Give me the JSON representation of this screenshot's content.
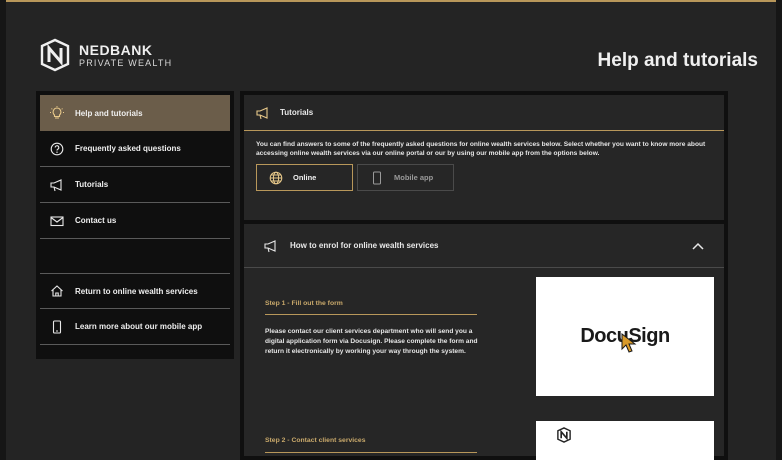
{
  "header": {
    "brand": "NEDBANK",
    "brand_sub": "PRIVATE WEALTH",
    "page_title": "Help and tutorials"
  },
  "sidebar": {
    "items": [
      {
        "label": "Help and tutorials",
        "icon": "lightbulb-icon",
        "active": true
      },
      {
        "label": "Frequently asked questions",
        "icon": "question-circle-icon"
      },
      {
        "label": "Tutorials",
        "icon": "megaphone-icon"
      },
      {
        "label": "Contact us",
        "icon": "envelope-icon"
      }
    ],
    "lower_items": [
      {
        "label": "Return to online wealth services",
        "icon": "home-icon"
      },
      {
        "label": "Learn more about our mobile app",
        "icon": "mobile-icon"
      }
    ]
  },
  "tutorials": {
    "heading": "Tutorials",
    "description": "You can find answers to some of the frequently asked questions for online wealth services below. Select whether you want to know more about accessing online wealth services via our online portal or our by using our mobile app from the options below.",
    "options": [
      {
        "label": "Online",
        "icon": "globe-icon",
        "selected": true
      },
      {
        "label": "Mobile app",
        "icon": "mobile-icon",
        "selected": false
      }
    ]
  },
  "enrol": {
    "heading": "How to enrol for online wealth services",
    "step1_title": "Step 1 - Fill out the form",
    "step1_body": "Please contact our client services department who will send you a digital application form via Docusign. Please complete the form and return it electronically by working your way through the system.",
    "step1_image_text": "DocuSign",
    "step2_title": "Step 2 - Contact client services"
  },
  "colors": {
    "accent_gold": "#b8975a",
    "background": "#242424",
    "panel": "#0f0f0f"
  }
}
